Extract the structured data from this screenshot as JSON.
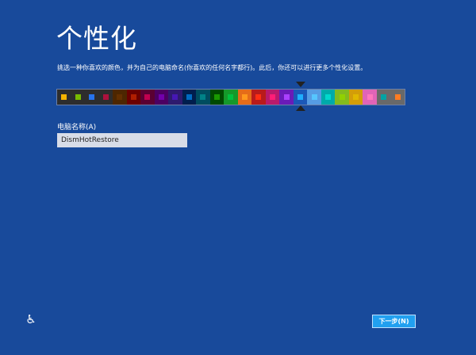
{
  "title": "个性化",
  "description": "挑选一种你喜欢的颜色，并为自己的电脑命名(你喜欢的任何名字都行)。此后，你还可以进行更多个性化设置。",
  "selected_swatch_index": 17,
  "swatches": [
    {
      "bg": "#2d2d2d",
      "fg": "#f4b300"
    },
    {
      "bg": "#2d2d2d",
      "fg": "#78ba00"
    },
    {
      "bg": "#2d2d2d",
      "fg": "#2673ec"
    },
    {
      "bg": "#2d2d2d",
      "fg": "#ae113d"
    },
    {
      "bg": "#4d2600",
      "fg": "#632f00"
    },
    {
      "bg": "#6b0000",
      "fg": "#b01e00"
    },
    {
      "bg": "#5a0032",
      "fg": "#c1004f"
    },
    {
      "bg": "#4c0062",
      "fg": "#7200ac"
    },
    {
      "bg": "#2e1a6e",
      "fg": "#4617b4"
    },
    {
      "bg": "#001e4e",
      "fg": "#006ac1"
    },
    {
      "bg": "#004d60",
      "fg": "#008287"
    },
    {
      "bg": "#004a00",
      "fg": "#199900"
    },
    {
      "bg": "#15992a",
      "fg": "#00c13f"
    },
    {
      "bg": "#e56c19",
      "fg": "#ff981d"
    },
    {
      "bg": "#b81b1b",
      "fg": "#ff2e12"
    },
    {
      "bg": "#b81b6c",
      "fg": "#ff1d77"
    },
    {
      "bg": "#691bb8",
      "fg": "#aa40ff"
    },
    {
      "bg": "#1b58b8",
      "fg": "#1faeff"
    },
    {
      "bg": "#569ce3",
      "fg": "#56c5ff"
    },
    {
      "bg": "#00aaaa",
      "fg": "#00d8cc"
    },
    {
      "bg": "#83ba1f",
      "fg": "#91d100"
    },
    {
      "bg": "#d39d09",
      "fg": "#e1b700"
    },
    {
      "bg": "#e064b7",
      "fg": "#ff76bc"
    },
    {
      "bg": "#696969",
      "fg": "#00a3a3"
    },
    {
      "bg": "#696969",
      "fg": "#fe7c22"
    }
  ],
  "pc_name": {
    "label": "电脑名称(A)",
    "value": "DismHotRestore"
  },
  "ease_icon": "ease-of-access-icon",
  "next_button": "下一步(N)"
}
